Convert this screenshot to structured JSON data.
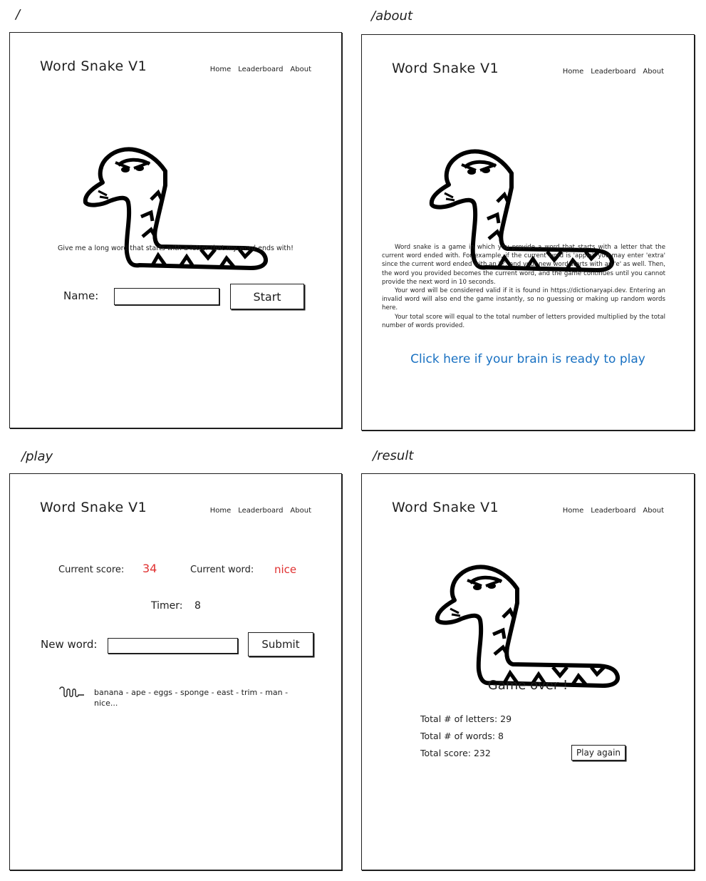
{
  "app_title": "Word Snake V1",
  "nav": [
    "Home",
    "Leaderboard",
    "About"
  ],
  "routes": {
    "home": "/",
    "about": "/about",
    "play": "/play",
    "result": "/result"
  },
  "home": {
    "tagline": "Give me a long word that starts with a letter that my word ends with!",
    "name_label": "Name:",
    "name_value": "",
    "start_button": "Start"
  },
  "about": {
    "paragraphs": [
      "Word snake is a game in which you provide a word that starts with a letter that the current word ended with. For example, if the current word is 'apple', you may enter 'extra' since the current word ended with an 'e', and your new word starts with an 'e' as well. Then, the word you provided becomes the current word, and the game continues until you cannot provide the next word in 10 seconds.",
      "Your word will be considered valid if it is found in https://dictionaryapi.dev. Entering an invalid word will also end the game instantly, so no guessing or making up random words here.",
      "Your total score will equal to the total number of letters provided multiplied by the total number of words provided."
    ],
    "play_link": "Click here if your brain is ready to play"
  },
  "play": {
    "score_label": "Current score:",
    "score_value": "34",
    "word_label": "Current word:",
    "word_value": "nice",
    "timer_label": "Timer:",
    "timer_value": "8",
    "new_word_label": "New word:",
    "new_word_value": "",
    "submit_button": "Submit",
    "history": "banana - ape - eggs - sponge - east - trim - man - nice..."
  },
  "result": {
    "heading": "Game over !",
    "letters_line": "Total # of letters: 29",
    "words_line": "Total # of words: 8",
    "score_line": "Total score: 232",
    "play_again_button": "Play again"
  },
  "colors": {
    "accent_red": "#e03131",
    "link_blue": "#1971c2",
    "ink": "#1e1e1e"
  },
  "icons": {
    "snake": "snake-illustration",
    "history": "squiggle-icon"
  }
}
